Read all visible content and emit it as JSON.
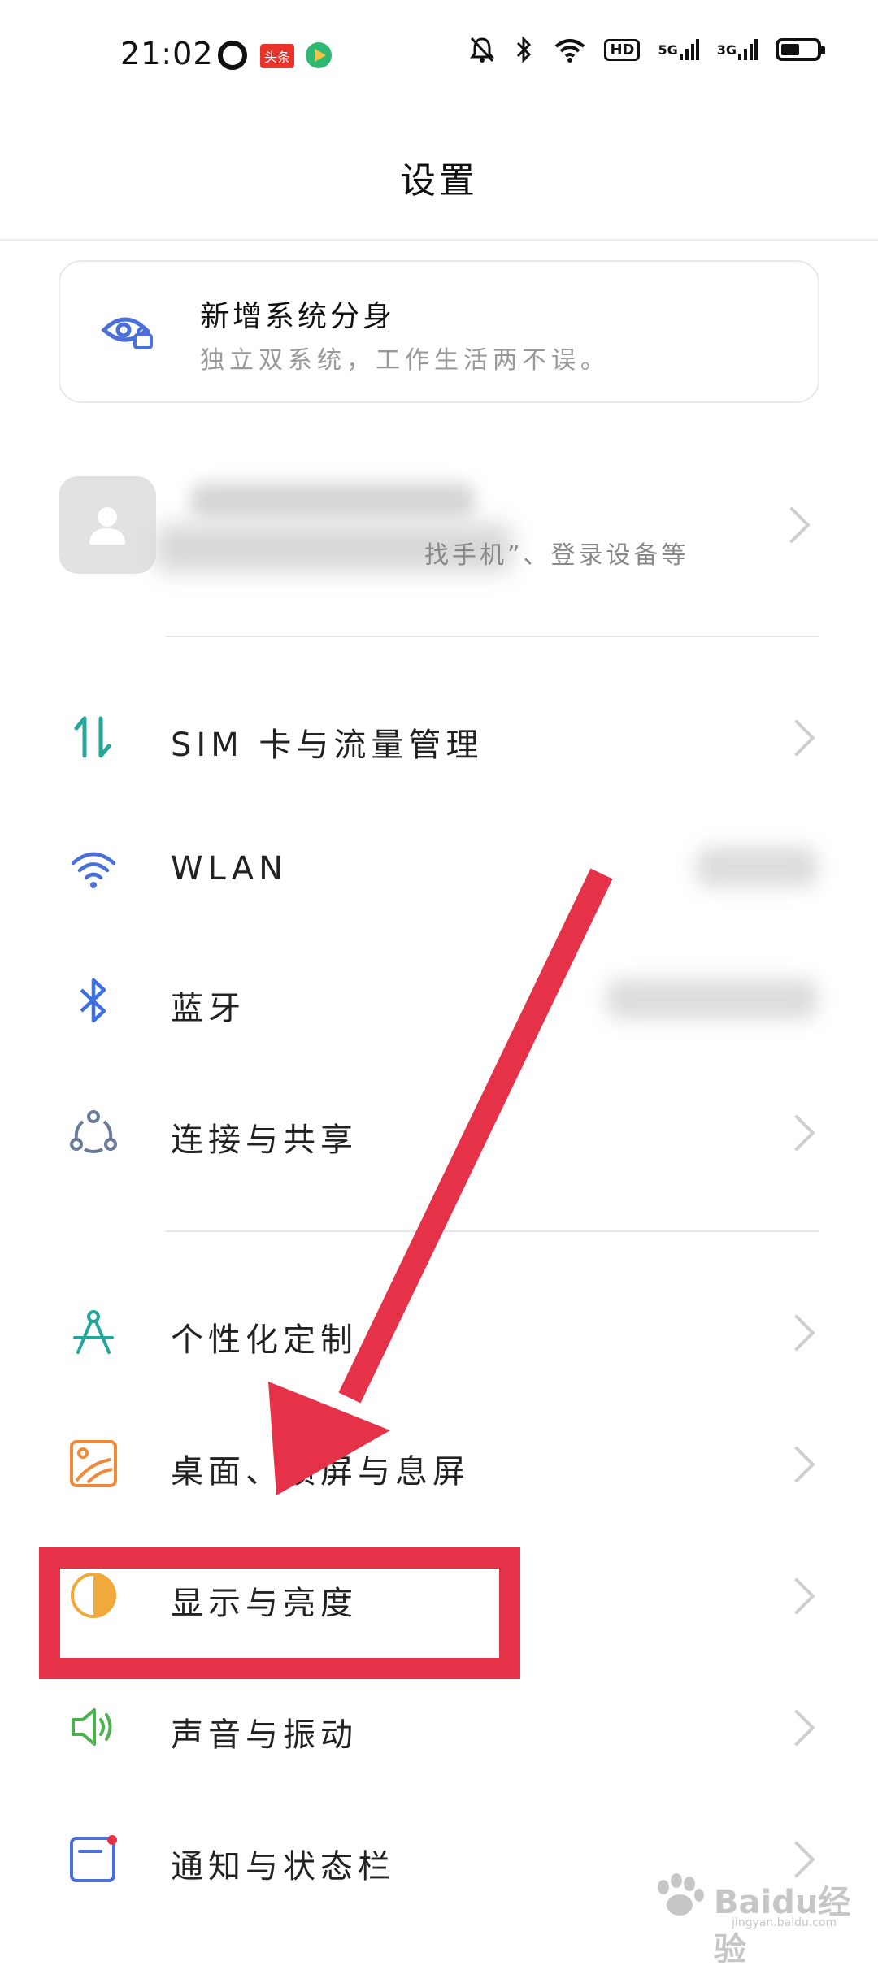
{
  "status_bar": {
    "time": "21:02",
    "toutiao_label": "头条",
    "net_5g": "5G",
    "net_3g": "3G",
    "hd_label": "HD"
  },
  "page_title": "设置",
  "promo": {
    "title": "新增系统分身",
    "subtitle": "独立双系统，工作生活两不误。",
    "icon": "eye-lock-icon"
  },
  "account": {
    "subtitle_visible": "找手机”、登录设备等"
  },
  "settings_groups": [
    [
      {
        "label": "SIM 卡与流量管理",
        "icon": "sim-data-icon",
        "color": "#26a69a"
      },
      {
        "label": "WLAN",
        "icon": "wifi-icon",
        "color": "#4a6fd8"
      },
      {
        "label": "蓝牙",
        "icon": "bluetooth-icon",
        "color": "#3d6fe0"
      },
      {
        "label": "连接与共享",
        "icon": "share-icon",
        "color": "#6a7a99"
      }
    ],
    [
      {
        "label": "个性化定制",
        "icon": "compass-icon",
        "color": "#26a69a"
      },
      {
        "label": "桌面、锁屏与息屏",
        "icon": "wallpaper-icon",
        "color": "#f08a3a"
      },
      {
        "label": "显示与亮度",
        "icon": "brightness-icon",
        "color": "#f0a93a"
      },
      {
        "label": "声音与振动",
        "icon": "speaker-icon",
        "color": "#4caf50"
      },
      {
        "label": "通知与状态栏",
        "icon": "notification-icon",
        "color": "#4a6fd8"
      }
    ]
  ],
  "accent_colors": {
    "annotation_red": "#e63248"
  },
  "watermark": {
    "brand": "Baidu经验",
    "url": "jingyan.baidu.com"
  }
}
